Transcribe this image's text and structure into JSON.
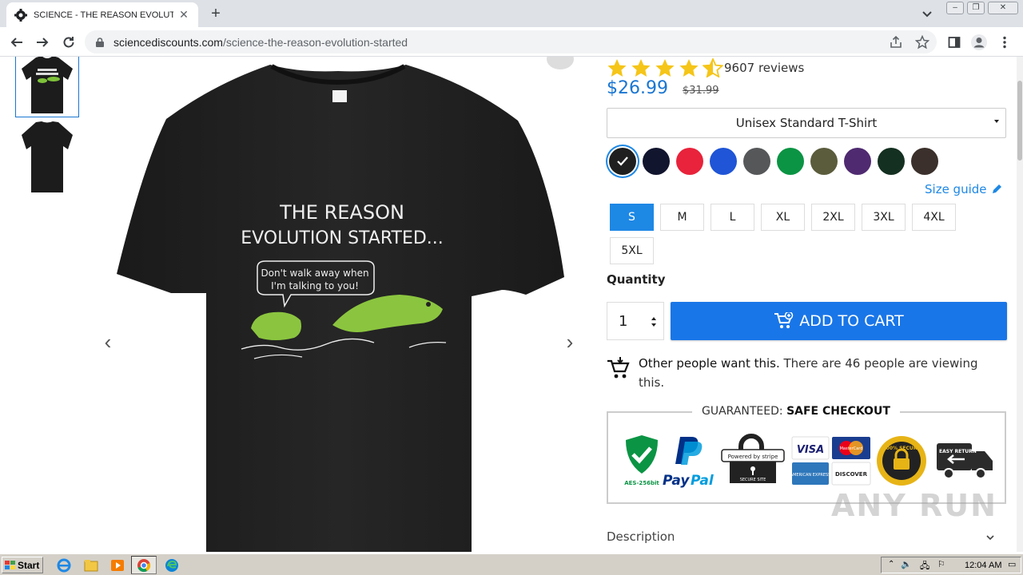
{
  "browser": {
    "tab_title": "SCIENCE - THE REASON EVOLUTION",
    "new_tab_label": "+",
    "url_domain": "sciencediscounts.com",
    "url_path": "/science-the-reason-evolution-started"
  },
  "product": {
    "shirt_print": {
      "headline_line1": "THE REASON",
      "headline_line2": "EVOLUTION STARTED...",
      "bubble_line1": "Don't walk away when",
      "bubble_line2": "I'm talking to you!"
    },
    "rating_stars": 4.5,
    "reviews": "9607 reviews",
    "price": "$26.99",
    "old_price": "$31.99",
    "style_selected": "Unisex Standard T-Shirt",
    "colors": [
      "#1f1f1f",
      "#12152e",
      "#e8233b",
      "#1f55d6",
      "#555759",
      "#0b9444",
      "#5b5c3c",
      "#4f2a70",
      "#143021",
      "#3b302b"
    ],
    "size_guide_label": "Size guide",
    "sizes": [
      "S",
      "M",
      "L",
      "XL",
      "2XL",
      "3XL",
      "4XL",
      "5XL"
    ],
    "selected_size": "S",
    "quantity_label": "Quantity",
    "quantity_value": "1",
    "add_to_cart_label": "ADD TO CART",
    "social_bold": "Other people want this.",
    "social_rest": " There are 46 people are viewing this.",
    "guarantee_prefix": "GUARANTEED: ",
    "guarantee_bold": "SAFE CHECKOUT",
    "badges": {
      "aes": "AES-256bit",
      "paypal_a": "Pay",
      "paypal_b": "Pal",
      "stripe_top": "Powered by stripe",
      "stripe_bottom": "SECURE SITE",
      "visa": "VISA",
      "mastercard": "MasterCard",
      "amex": "AMERICAN EXPRESS",
      "discover": "DISCOVER",
      "secure_seal": "100% SECURE",
      "easy_return": "EASY RETURN"
    },
    "description_label": "Description"
  },
  "watermark": "ANY RUN",
  "taskbar": {
    "start_label": "Start",
    "time": "12:04 AM"
  },
  "colors": {
    "accent": "#1976e8",
    "price": "#1976d2",
    "star": "#f5c518"
  }
}
